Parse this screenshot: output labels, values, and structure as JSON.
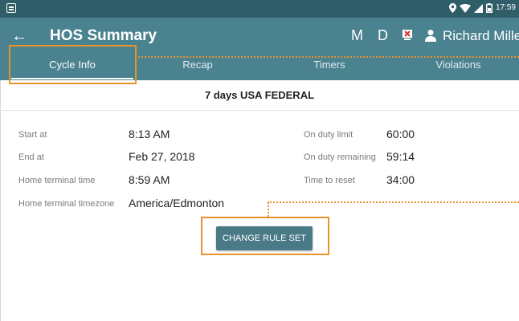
{
  "status_bar": {
    "time": "17:59",
    "icons": [
      "screenshot-icon",
      "location-icon",
      "wifi-icon",
      "signal-icon",
      "battery-icon"
    ]
  },
  "app_bar": {
    "back_icon": "back-arrow-icon",
    "title": "HOS Summary",
    "m_label": "M",
    "d_label": "D",
    "user_name": "Richard Miller"
  },
  "tabs": [
    {
      "label": "Cycle Info",
      "active": true
    },
    {
      "label": "Recap",
      "active": false
    },
    {
      "label": "Timers",
      "active": false
    },
    {
      "label": "Violations",
      "active": false
    }
  ],
  "rule_set_title": "7 days USA FEDERAL",
  "left_fields": [
    {
      "label": "Start at",
      "value": "8:13 AM"
    },
    {
      "label": "End at",
      "value": "Feb 27, 2018"
    },
    {
      "label": "Home terminal time",
      "value": "8:59 AM"
    },
    {
      "label": "Home terminal timezone",
      "value": "America/Edmonton"
    }
  ],
  "right_fields": [
    {
      "label": "On duty limit",
      "value": "60:00"
    },
    {
      "label": "On duty remaining",
      "value": "59:14"
    },
    {
      "label": "Time to reset",
      "value": "34:00"
    }
  ],
  "change_button_label": "CHANGE RULE SET",
  "colors": {
    "status_bar": "#2f5e68",
    "app_bar": "#4a8290",
    "button": "#4a7a86",
    "highlight": "#e8922c"
  }
}
